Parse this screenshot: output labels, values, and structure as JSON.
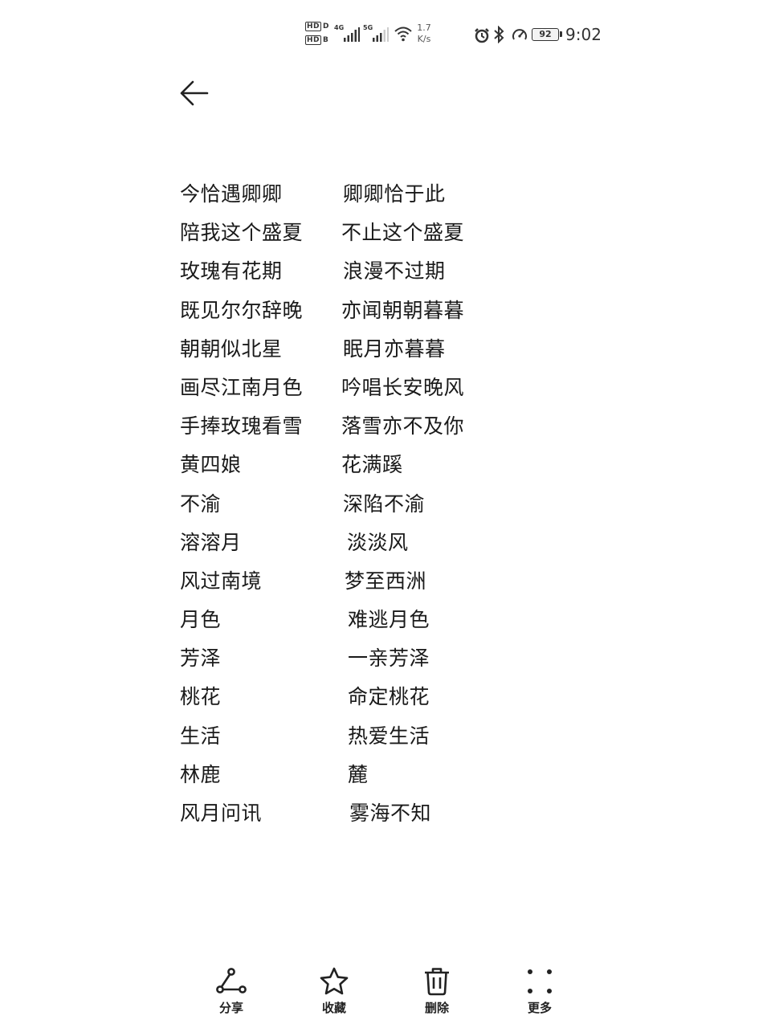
{
  "status_bar": {
    "hd_1": "HD",
    "hd_1_suffix": "D",
    "hd_2": "HD",
    "hd_2_suffix": "B",
    "signal_1_label": "4G",
    "signal_2_label": "5G",
    "speed_value": "1.7",
    "speed_unit": "K/s",
    "battery_level": "92",
    "time": "9:02",
    "icons": [
      "alarm-icon",
      "bluetooth-icon",
      "performance-icon"
    ]
  },
  "back_icon": "arrow-left-icon",
  "poem": {
    "lines": [
      {
        "left": "今恰遇卿卿",
        "right": "卿卿恰于此"
      },
      {
        "left": "陪我这个盛夏",
        "right": "不止这个盛夏"
      },
      {
        "left": "玫瑰有花期",
        "right": "浪漫不过期"
      },
      {
        "left": "既见尔尔辞晚",
        "right": "亦闻朝朝暮暮"
      },
      {
        "left": "朝朝似北星",
        "right": "眠月亦暮暮"
      },
      {
        "left": "画尽江南月色",
        "right": "吟唱长安晚风"
      },
      {
        "left": "手捧玫瑰看雪",
        "right": "落雪亦不及你"
      },
      {
        "left": "黄四娘",
        "right": "花满蹊"
      },
      {
        "left": "不渝",
        "right": "深陷不渝"
      },
      {
        "left": "溶溶月",
        "right": "淡淡风"
      },
      {
        "left": "风过南境",
        "right": "梦至西洲"
      },
      {
        "left": "月色",
        "right": "难逃月色"
      },
      {
        "left": "芳泽",
        "right": "一亲芳泽"
      },
      {
        "left": "桃花",
        "right": "命定桃花"
      },
      {
        "left": "生活",
        "right": "热爱生活"
      },
      {
        "left": "林鹿",
        "right": "麓"
      },
      {
        "left": "风月问讯",
        "right": "雾海不知"
      }
    ]
  },
  "toolbar": {
    "items": [
      {
        "label": "分享",
        "icon": "share-icon"
      },
      {
        "label": "收藏",
        "icon": "star-icon"
      },
      {
        "label": "删除",
        "icon": "trash-icon"
      },
      {
        "label": "更多",
        "icon": "more-icon"
      }
    ]
  }
}
